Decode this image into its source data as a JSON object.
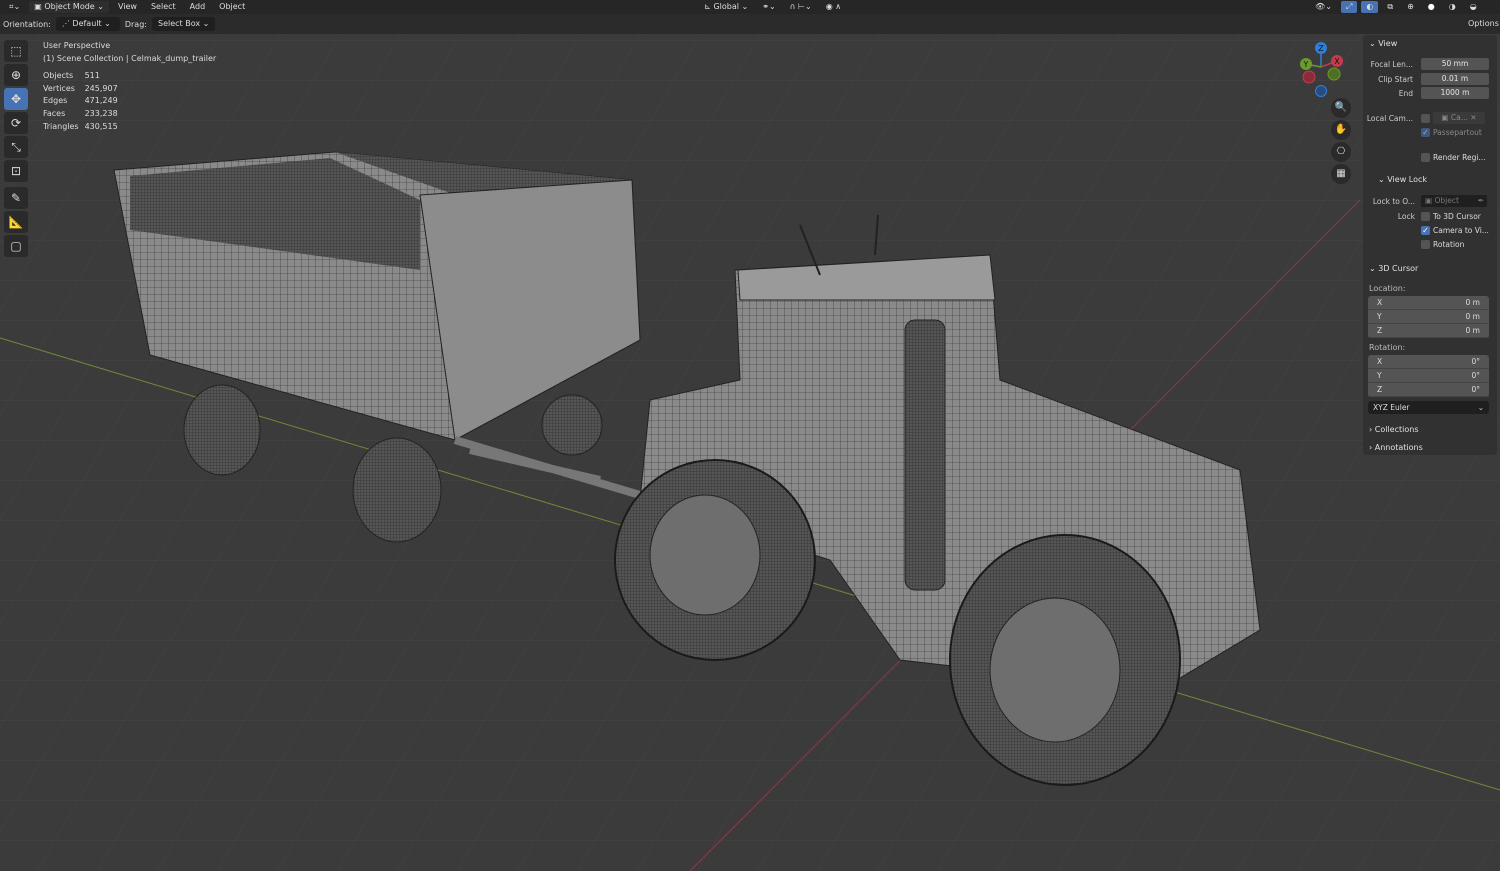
{
  "header": {
    "mode": "Object Mode",
    "menus": [
      "View",
      "Select",
      "Add",
      "Object"
    ],
    "transform": "Global"
  },
  "toolsettings": {
    "orientation_label": "Orientation:",
    "orientation": "Default",
    "drag_label": "Drag:",
    "drag": "Select Box",
    "options": "Options"
  },
  "overlay": {
    "view_name": "User Perspective",
    "collection": "(1) Scene Collection | Celmak_dump_trailer",
    "stats": [
      {
        "k": "Objects",
        "v": "511"
      },
      {
        "k": "Vertices",
        "v": "245,907"
      },
      {
        "k": "Edges",
        "v": "471,249"
      },
      {
        "k": "Faces",
        "v": "233,238"
      },
      {
        "k": "Triangles",
        "v": "430,515"
      }
    ]
  },
  "gizmo": {
    "x": "X",
    "y": "Y",
    "z": "Z",
    "colors": {
      "x": "#c33b4c",
      "y": "#6b9a2d",
      "z": "#2f7fd9"
    }
  },
  "npanel": {
    "view": {
      "title": "View",
      "focal_label": "Focal Len...",
      "focal": "50 mm",
      "clip_start_label": "Clip Start",
      "clip_start": "0.01 m",
      "end_label": "End",
      "end": "1000 m",
      "local_cam_label": "Local Cam...",
      "local_cam_value": "Ca...",
      "passepartout": "Passepartout",
      "render_region": "Render Regi..."
    },
    "view_lock": {
      "title": "View Lock",
      "lock_to_label": "Lock to O...",
      "lock_to_placeholder": "Object",
      "lock_label": "Lock",
      "to_cursor": "To 3D Cursor",
      "camera_to_view": "Camera to Vi...",
      "rotation": "Rotation"
    },
    "cursor": {
      "title": "3D Cursor",
      "location_label": "Location:",
      "loc": [
        {
          "a": "X",
          "v": "0 m"
        },
        {
          "a": "Y",
          "v": "0 m"
        },
        {
          "a": "Z",
          "v": "0 m"
        }
      ],
      "rotation_label": "Rotation:",
      "rot": [
        {
          "a": "X",
          "v": "0°"
        },
        {
          "a": "Y",
          "v": "0°"
        },
        {
          "a": "Z",
          "v": "0°"
        }
      ],
      "mode": "XYZ Euler"
    },
    "collections": "Collections",
    "annotations": "Annotations"
  },
  "accent": "#4772b3"
}
